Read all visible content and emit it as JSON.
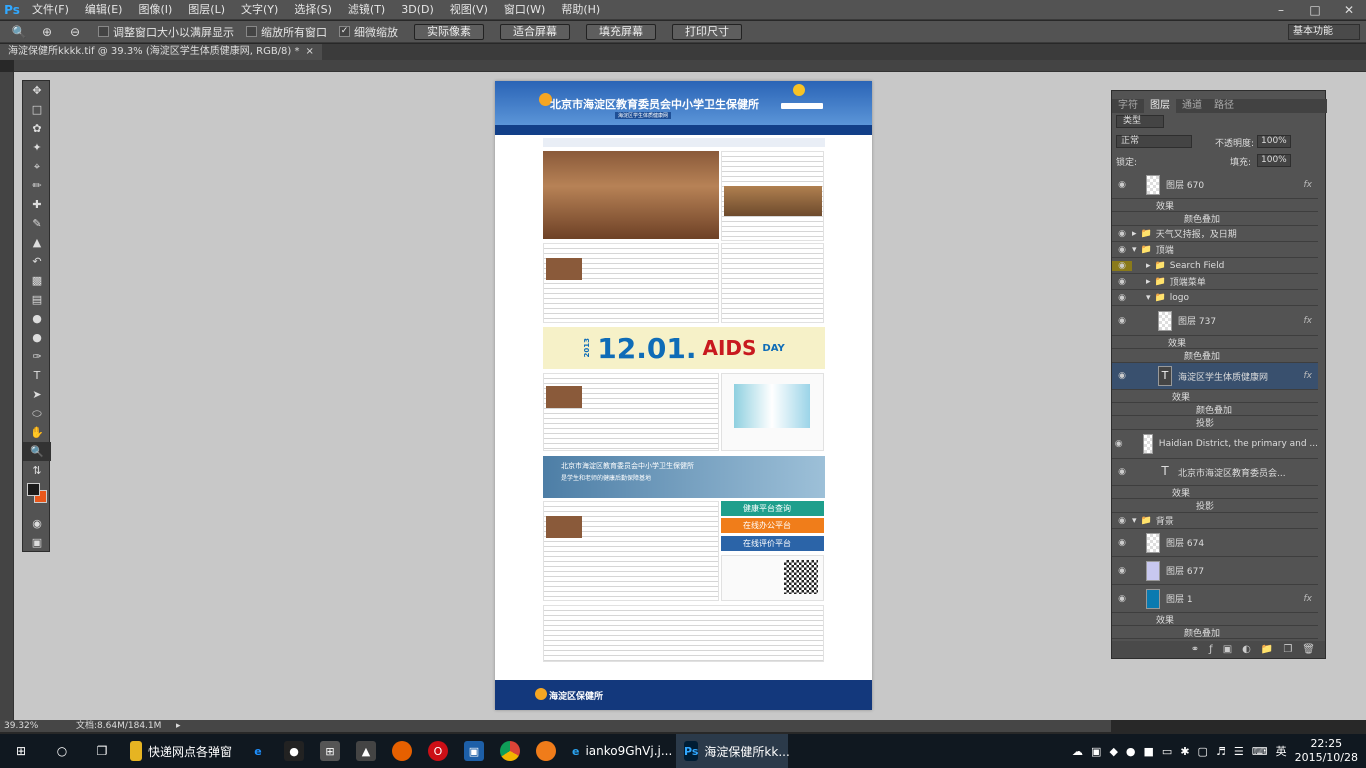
{
  "app": {
    "logo": "Ps",
    "menus": [
      "文件(F)",
      "编辑(E)",
      "图像(I)",
      "图层(L)",
      "文字(Y)",
      "选择(S)",
      "滤镜(T)",
      "3D(D)",
      "视图(V)",
      "窗口(W)",
      "帮助(H)"
    ],
    "window_controls": [
      "–",
      "□",
      "✕"
    ]
  },
  "options": {
    "resize_windows": "调整窗口大小以满屏显示",
    "zoom_all": "缩放所有窗口",
    "scrubby_zoom": "细微缩放",
    "buttons": [
      "实际像素",
      "适合屏幕",
      "填充屏幕",
      "打印尺寸"
    ],
    "workspace": "基本功能"
  },
  "document": {
    "tab_title": "海淀保健所kkkk.tif @ 39.3% (海淀区学生体质健康网, RGB/8) *",
    "close": "×"
  },
  "page": {
    "title": "北京市海淀区教育委员会中小学卫生保健所",
    "subtitle": "海淀区学生体质健康网",
    "aids_year": "2013",
    "aids_date": "12.01.",
    "aids_word": "AIDS",
    "aids_day": "DAY",
    "banner_line1": "北京市海淀区教育委员会中小学卫生保健所",
    "banner_line2": "是学生和老师的健康后勤保障基地",
    "services": [
      "健康平台查询",
      "在线办公平台",
      "在线评价平台"
    ],
    "footer_name": "海淀区保健所"
  },
  "layers_panel": {
    "tabs": [
      "字符",
      "图层",
      "通道",
      "路径"
    ],
    "filter": "类型",
    "blend_mode": "正常",
    "opacity_label": "不透明度:",
    "opacity": "100%",
    "lock_label": "锁定:",
    "fill_label": "填充:",
    "fill": "100%",
    "rows": [
      {
        "label": "图层 670",
        "fx": "fx"
      },
      {
        "label": "效果"
      },
      {
        "label": "颜色叠加"
      },
      {
        "label": "天气又持报，及日期"
      },
      {
        "label": "顶端"
      },
      {
        "label": "Search Field"
      },
      {
        "label": "顶端菜单"
      },
      {
        "label": "logo"
      },
      {
        "label": "图层 737",
        "fx": "fx"
      },
      {
        "label": "效果"
      },
      {
        "label": "颜色叠加"
      },
      {
        "label": "海淀区学生体质健康网",
        "fx": "fx"
      },
      {
        "label": "效果"
      },
      {
        "label": "颜色叠加"
      },
      {
        "label": "投影"
      },
      {
        "label": "Haidian District, the primary and ..."
      },
      {
        "label": "北京市海淀区教育委员会...",
        "fx": "fx"
      },
      {
        "label": "效果"
      },
      {
        "label": "投影"
      },
      {
        "label": "背景"
      },
      {
        "label": "图层 674"
      },
      {
        "label": "图层 677"
      },
      {
        "label": "图层 1",
        "fx": "fx"
      },
      {
        "label": "效果"
      },
      {
        "label": "颜色叠加"
      }
    ]
  },
  "status": {
    "zoom": "39.32%",
    "doc_size": "文档:8.64M/184.1M"
  },
  "taskbar": {
    "apps": [
      "快递网点各弹窗",
      "ianko9GhVj.j...",
      "海淀保健所kk..."
    ],
    "lang": "英",
    "time": "22:25",
    "date": "2015/10/28"
  },
  "colors": {
    "ps_blue": "#31a8ff",
    "page_header": "#2a64b6",
    "services": [
      "#1f9f8c",
      "#f07d1a",
      "#2b64a8"
    ],
    "fg_color": "#1a1a1a",
    "bg_color": "#e8571b"
  }
}
